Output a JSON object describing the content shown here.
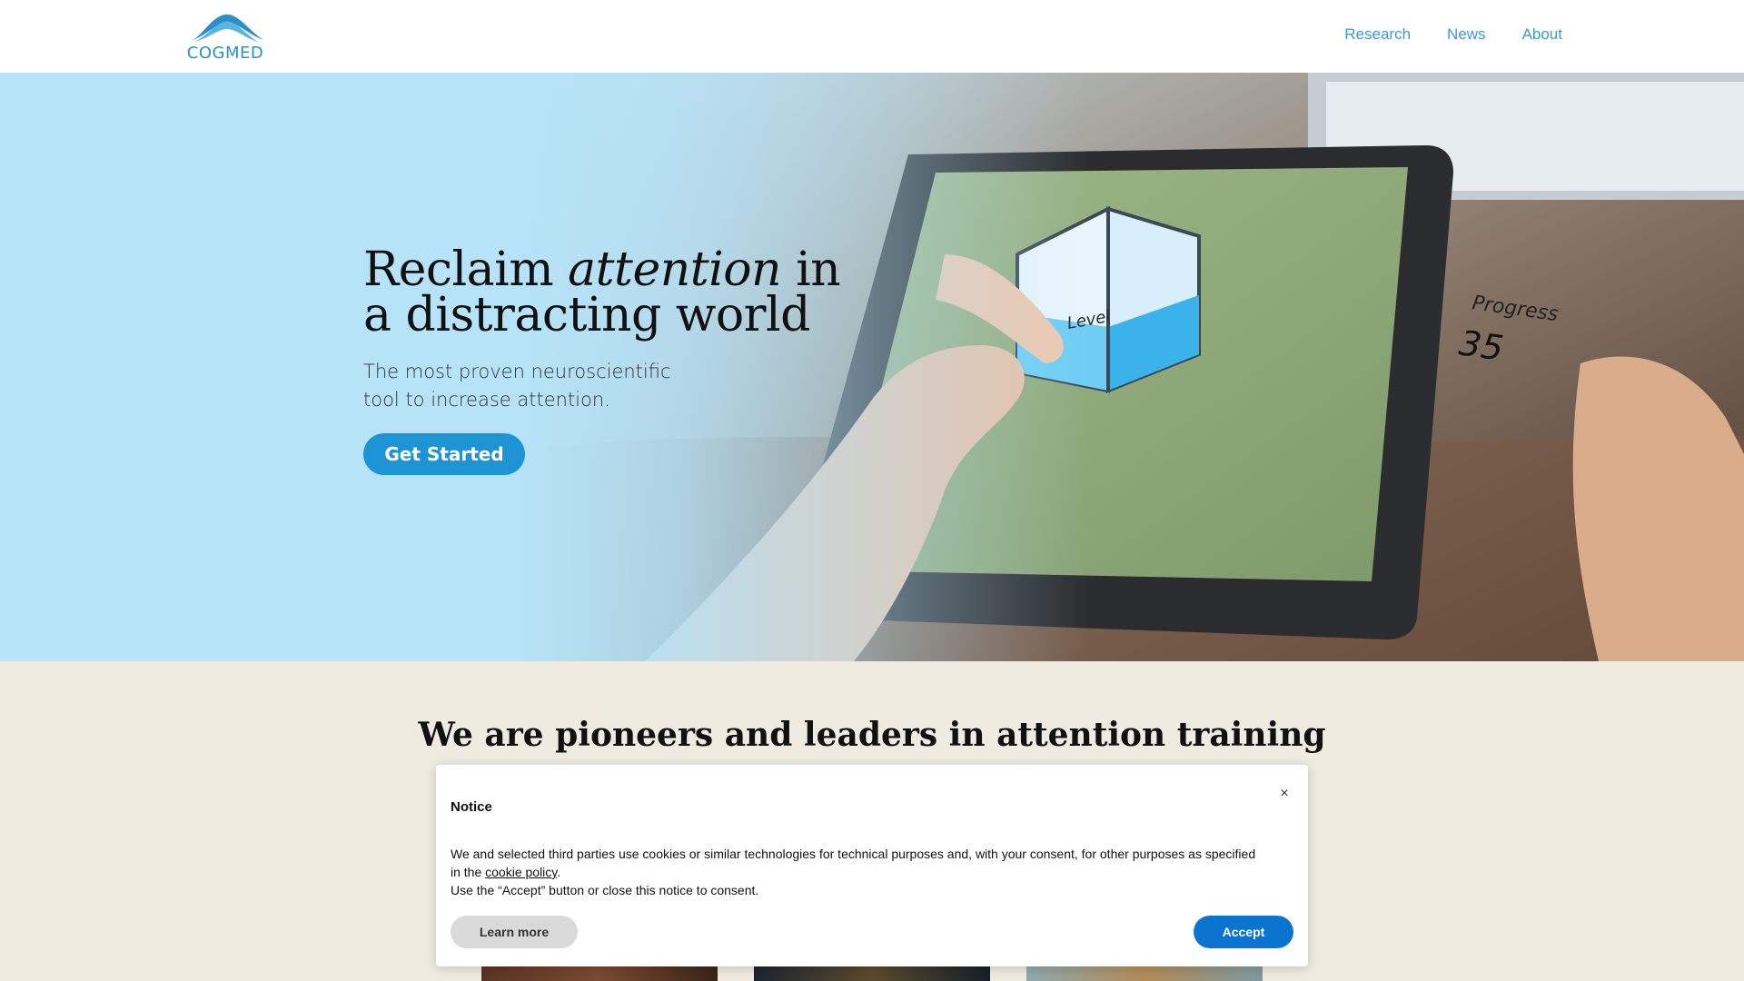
{
  "header": {
    "logo_text": "COGMED",
    "nav": [
      {
        "label": "Research"
      },
      {
        "label": "News"
      },
      {
        "label": "About"
      }
    ]
  },
  "hero": {
    "title_part1": "Reclaim ",
    "title_emphasis": "attention",
    "title_part2": " in a distracting world",
    "subtitle": "The most proven neuroscientific tool to increase attention.",
    "cta_label": "Get Started",
    "photo_labels": {
      "level": "Level",
      "progress": "Progress",
      "progress_value": "35"
    }
  },
  "section": {
    "title": "We are pioneers and leaders in attention training"
  },
  "cookie_notice": {
    "close_label": "×",
    "title": "Notice",
    "body_part1": "We and selected third parties use cookies or similar technologies for technical purposes and, with your consent, for other purposes as specified in the ",
    "link_text": "cookie policy",
    "body_part2": ".",
    "body_line2": "Use the “Accept” button or close this notice to consent.",
    "learn_more_label": "Learn more",
    "accept_label": "Accept"
  },
  "colors": {
    "brand_blue": "#1d95d4",
    "hero_bg": "#b6e3f8",
    "section_bg": "#efebe1",
    "accept_blue": "#0a74cf"
  }
}
